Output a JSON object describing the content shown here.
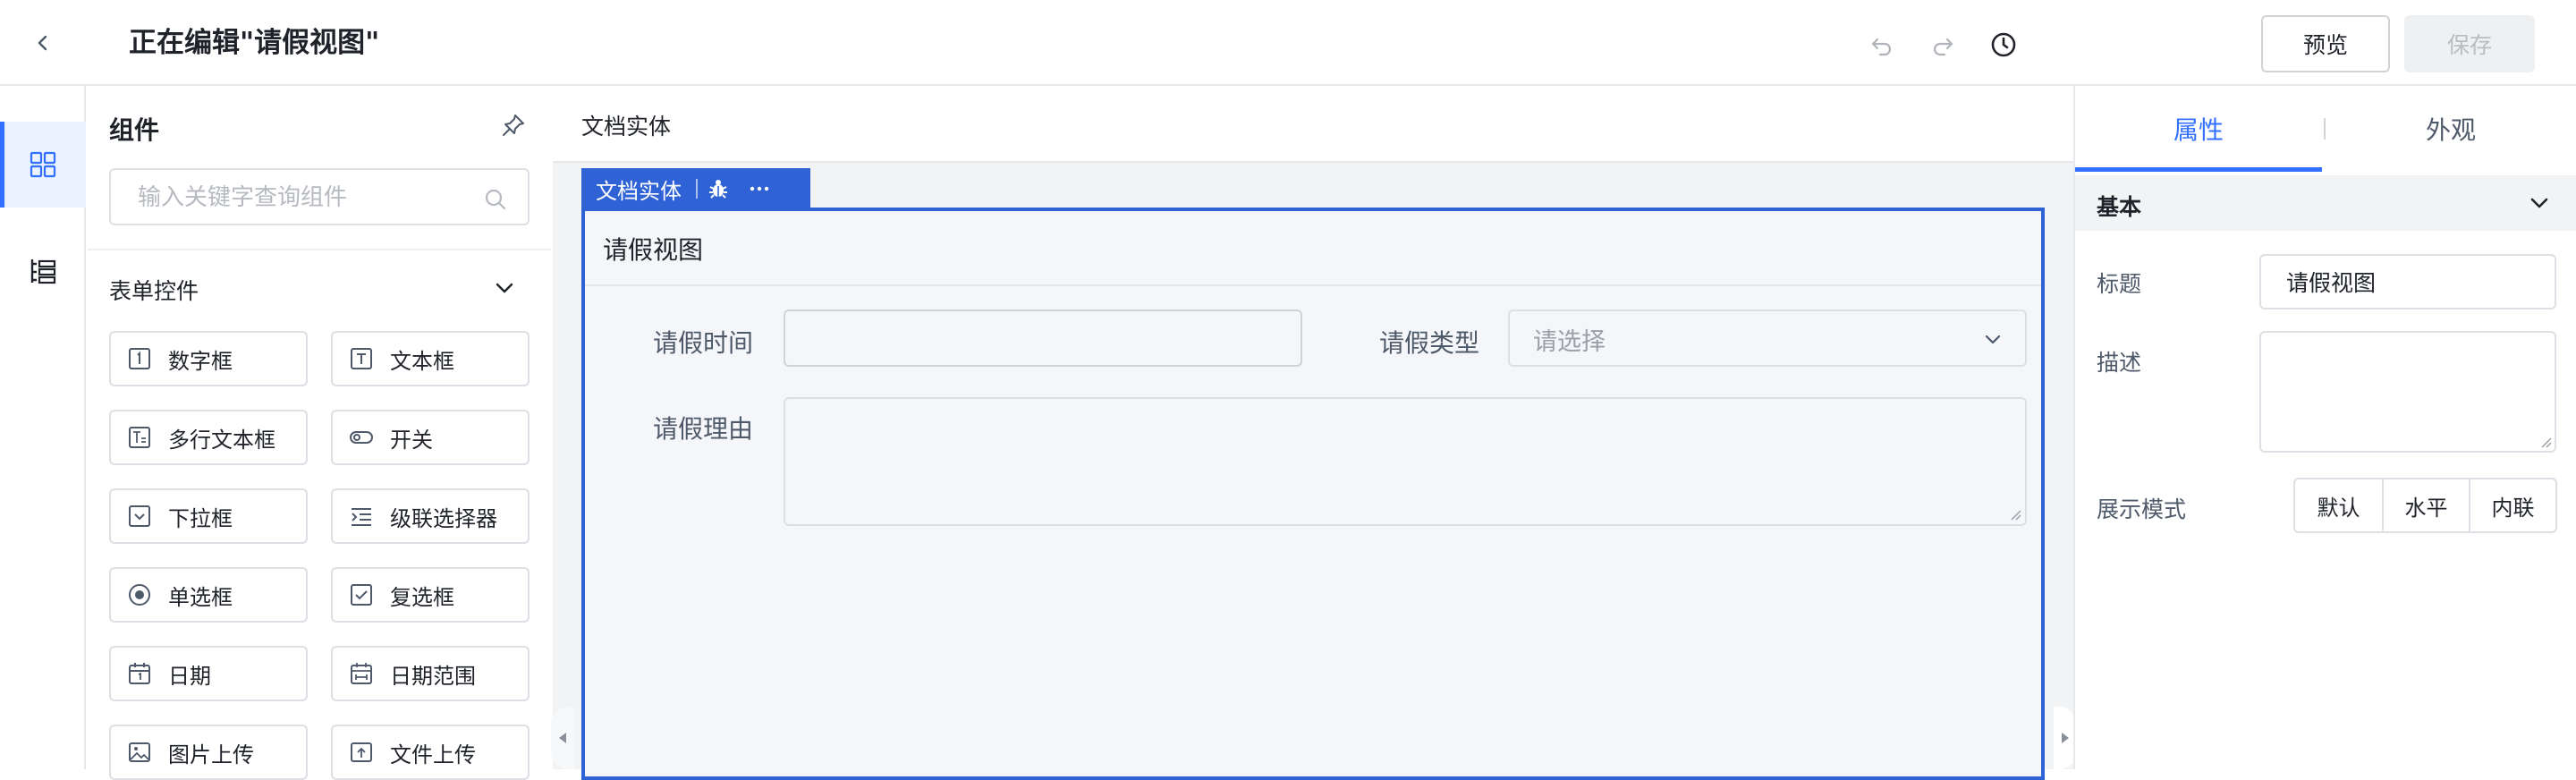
{
  "header": {
    "title": "正在编辑\"请假视图\"",
    "preview_label": "预览",
    "save_label": "保存"
  },
  "components": {
    "title": "组件",
    "search_placeholder": "输入关键字查询组件",
    "group_title": "表单控件",
    "items": [
      {
        "label": "数字框",
        "icon": "number-box-icon"
      },
      {
        "label": "文本框",
        "icon": "text-box-icon"
      },
      {
        "label": "多行文本框",
        "icon": "multiline-text-icon"
      },
      {
        "label": "开关",
        "icon": "switch-icon"
      },
      {
        "label": "下拉框",
        "icon": "dropdown-icon"
      },
      {
        "label": "级联选择器",
        "icon": "cascader-icon"
      },
      {
        "label": "单选框",
        "icon": "radio-icon"
      },
      {
        "label": "复选框",
        "icon": "checkbox-icon"
      },
      {
        "label": "日期",
        "icon": "date-icon"
      },
      {
        "label": "日期范围",
        "icon": "date-range-icon"
      },
      {
        "label": "图片上传",
        "icon": "image-upload-icon"
      },
      {
        "label": "文件上传",
        "icon": "file-upload-icon"
      }
    ]
  },
  "canvas": {
    "header_title": "文档实体",
    "selection_tag": "文档实体",
    "form_title": "请假视图",
    "fields": {
      "leave_time": "请假时间",
      "leave_type": "请假类型",
      "leave_type_placeholder": "请选择",
      "leave_reason": "请假理由"
    }
  },
  "properties": {
    "tabs": [
      "属性",
      "外观"
    ],
    "active_tab": "属性",
    "section": "基本",
    "title_label": "标题",
    "title_value": "请假视图",
    "desc_label": "描述",
    "display_label": "展示模式",
    "display_options": [
      "默认",
      "水平",
      "内联"
    ]
  },
  "colors": {
    "accent": "#3370ff",
    "selection": "#2f63d5"
  }
}
